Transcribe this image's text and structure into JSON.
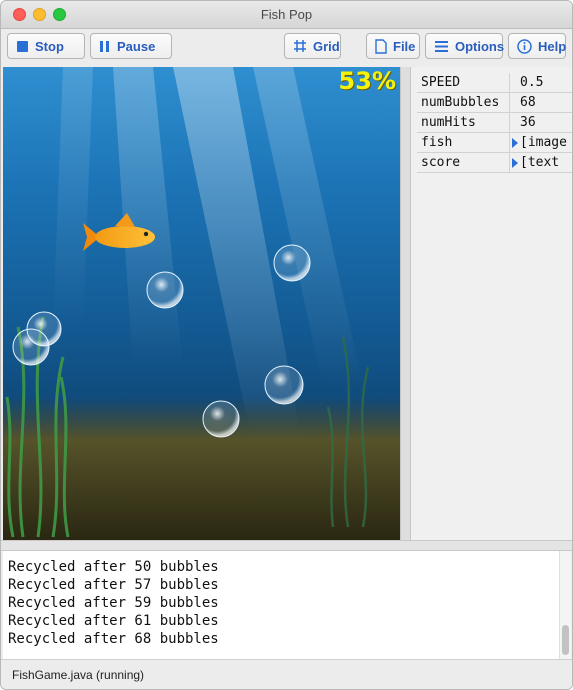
{
  "window": {
    "title": "Fish Pop"
  },
  "toolbar": {
    "stop_label": "Stop",
    "pause_label": "Pause",
    "grid_label": "Grid",
    "file_label": "File",
    "options_label": "Options",
    "help_label": "Help"
  },
  "game": {
    "progress_text": "53%"
  },
  "inspector": {
    "rows": [
      {
        "key": "SPEED",
        "value": "0.5"
      },
      {
        "key": "numBubbles",
        "value": "68"
      },
      {
        "key": "numHits",
        "value": "36"
      },
      {
        "key": "fish",
        "value": "[image"
      },
      {
        "key": "score",
        "value": "[text"
      }
    ]
  },
  "console": {
    "lines": [
      "Recycled after 50 bubbles",
      "Recycled after 57 bubbles",
      "Recycled after 59 bubbles",
      "Recycled after 61 bubbles",
      "Recycled after 68 bubbles"
    ]
  },
  "status": {
    "text": "FishGame.java (running)"
  },
  "colors": {
    "accent": "#2a5dbd",
    "score": "#f6f20c"
  }
}
